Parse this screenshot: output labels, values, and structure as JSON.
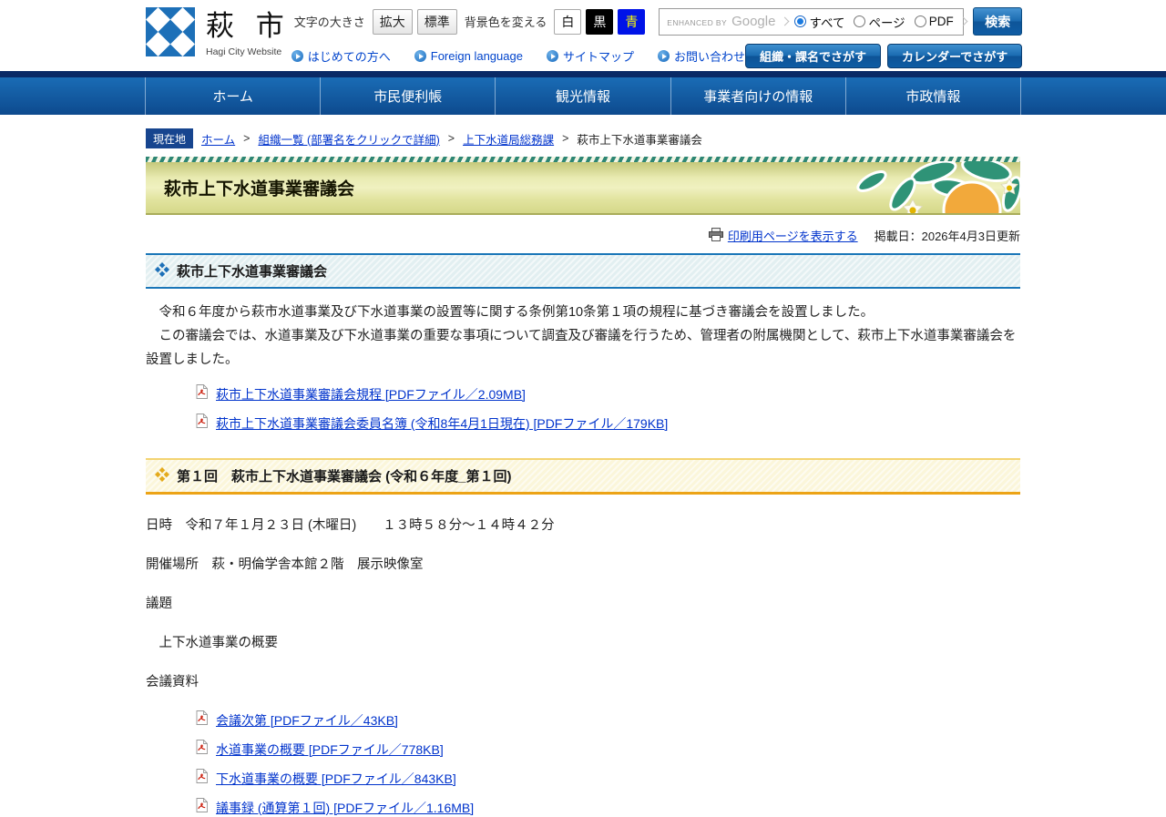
{
  "colors": {
    "nav_blue_top": "#1a6cb5",
    "nav_blue_bottom": "#0d4a8e",
    "nav_dark_border": "#0a2a66",
    "link_blue": "#0033cc",
    "badge_blue": "#17458f",
    "banner_stripe_green": "#2e8674",
    "banner_yellow": "#f0f1c0",
    "section_blue_border": "#1a76b8",
    "section_yellow_border": "#eca316",
    "logo_blue": "#1d70b8",
    "pdf_icon_red": "#cc2211",
    "bg_button_blue": "#0013e8",
    "bg_button_blue_text": "#ffff00",
    "citrus_orange": "#f2a93b",
    "leaf_green": "#2f9377"
  },
  "header": {
    "site_name": "萩 市",
    "site_subtitle": "Hagi City Website",
    "text_size_label": "文字の大きさ",
    "text_size_buttons": [
      "拡大",
      "標準"
    ],
    "bg_color_label": "背景色を変える",
    "bg_color_buttons": [
      "白",
      "黒",
      "青"
    ],
    "quick_links": [
      "はじめての方へ",
      "Foreign language",
      "サイトマップ",
      "お問い合わせ"
    ],
    "search": {
      "watermark_prefix": "ENHANCED BY",
      "watermark_brand": "Google",
      "options": [
        "すべて",
        "ページ",
        "PDF"
      ],
      "selected_option": "すべて",
      "button_label": "検索"
    },
    "finder_buttons": [
      "組織・課名でさがす",
      "カレンダーでさがす"
    ]
  },
  "nav": {
    "items": [
      "ホーム",
      "市民便利帳",
      "観光情報",
      "事業者向けの情報",
      "市政情報"
    ]
  },
  "breadcrumb": {
    "badge": "現在地",
    "links": [
      "ホーム",
      "組織一覧 (部署名をクリックで詳細) ",
      "上下水道局総務課"
    ],
    "current": "萩市上下水道事業審議会"
  },
  "page": {
    "title": "萩市上下水道事業審議会",
    "print_link": "印刷用ページを表示する",
    "published": "掲載日：2026年4月3日更新"
  },
  "section1": {
    "heading": "萩市上下水道事業審議会",
    "para_line1": "　令和６年度から萩市水道事業及び下水道事業の設置等に関する条例第10条第１項の規程に基づき審議会を設置しました。",
    "para_line2": "　この審議会では、水道事業及び下水道事業の重要な事項について調査及び審議を行うため、管理者の附属機関として、萩市上下水道事業審議会を設置しました。",
    "pdf_links": [
      "萩市上下水道事業審議会規程 [PDFファイル／2.09MB]",
      "萩市上下水道事業審議会委員名簿 (令和8年4月1日現在)  [PDFファイル／179KB]"
    ]
  },
  "section2": {
    "heading": "第１回　萩市上下水道事業審議会 (令和６年度_第１回)",
    "datetime": "日時　令和７年１月２３日 (木曜日)　　１３時５８分～１４時４２分",
    "location": "開催場所　萩・明倫学舎本館２階　展示映像室",
    "agenda_label": "議題",
    "agenda_item": "　上下水道事業の概要",
    "materials_label": "会議資料",
    "pdf_links": [
      "会議次第 [PDFファイル／43KB]",
      "水道事業の概要 [PDFファイル／778KB]",
      "下水道事業の概要 [PDFファイル／843KB]",
      "議事録 (通算第１回)  [PDFファイル／1.16MB]"
    ]
  }
}
